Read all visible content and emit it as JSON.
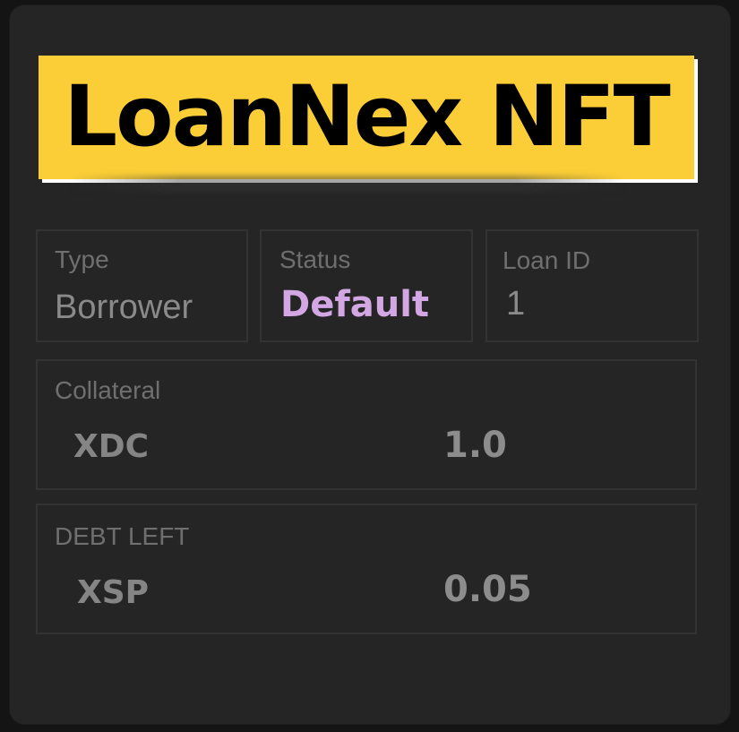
{
  "nft": {
    "title": "LoanNex NFT"
  },
  "info": {
    "type_label": "Type",
    "type_value": "Borrower",
    "status_label": "Status",
    "status_value": "Default",
    "loan_id_label": "Loan ID",
    "loan_id_value": "1"
  },
  "collateral": {
    "label": "Collateral",
    "token": "XDC",
    "amount": "1.0"
  },
  "debt": {
    "label": "DEBT LEFT",
    "token": "XSP",
    "amount": "0.05"
  },
  "colors": {
    "title_bg": "#fbce37",
    "status_accent": "#d3a7e3",
    "card_bg": "#252525"
  }
}
